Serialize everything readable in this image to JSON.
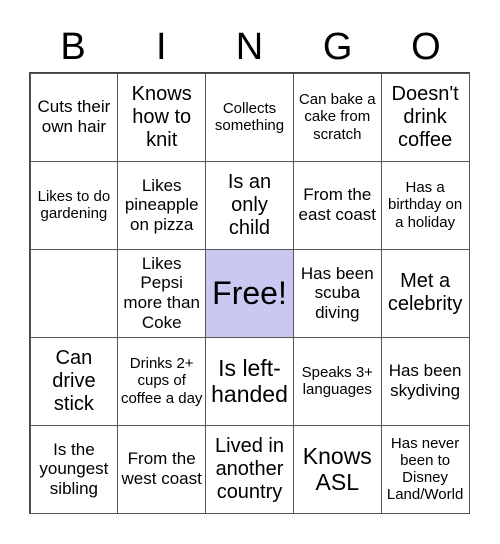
{
  "header": [
    "B",
    "I",
    "N",
    "G",
    "O"
  ],
  "colors": {
    "free_cell": "#c8c8f0",
    "grid_line": "#555555"
  },
  "cells": [
    "Cuts their own hair",
    "Knows how to knit",
    "Collects something",
    "Can bake a cake from scratch",
    "Doesn't drink coffee",
    "Likes to do gardening",
    "Likes pineapple on pizza",
    "Is an only child",
    "From the east coast",
    "Has a birthday on a holiday",
    "",
    "Likes Pepsi more than Coke",
    "Free!",
    "Has been scuba diving",
    "Met a celebrity",
    "Can drive stick",
    "Drinks 2+ cups of coffee a day",
    "Is left-handed",
    "Speaks 3+ languages",
    "Has been skydiving",
    "Is the youngest sibling",
    "From the west coast",
    "Lived in another country",
    "Knows ASL",
    "Has never been to Disney Land/World"
  ]
}
